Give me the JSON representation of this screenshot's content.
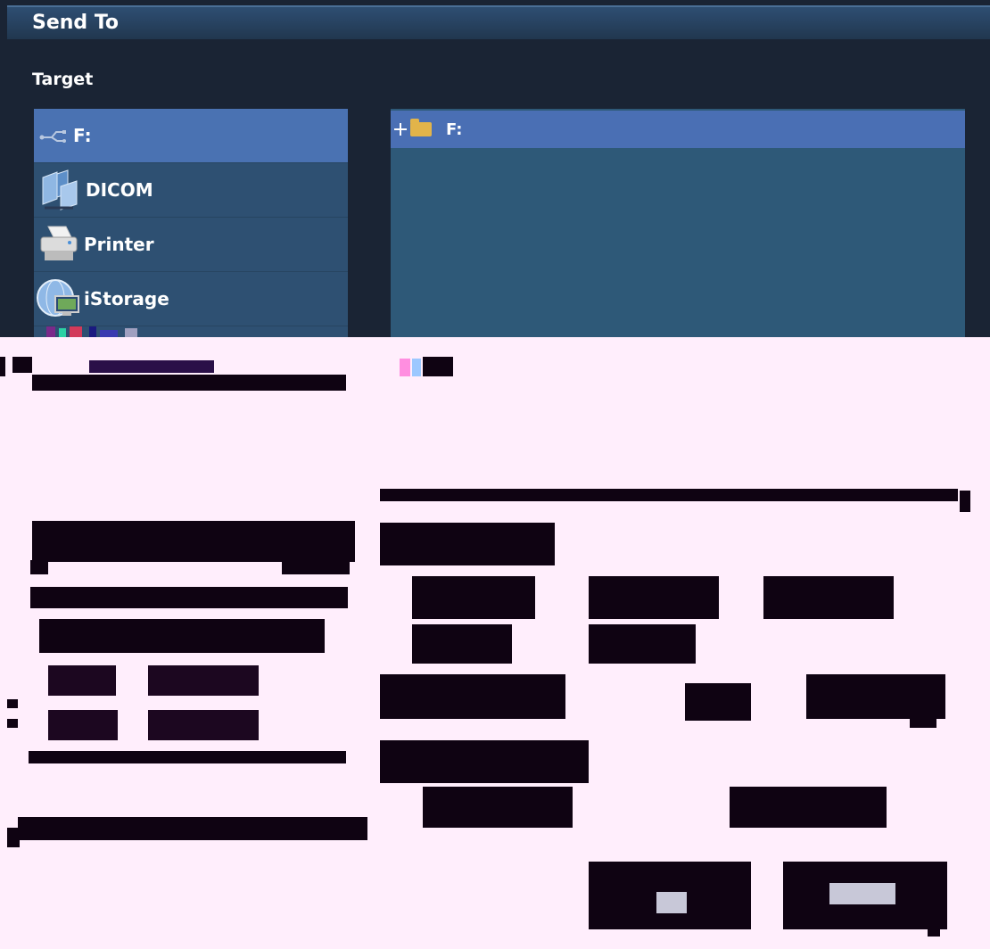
{
  "dialog": {
    "title": "Send To",
    "section_label": "Target"
  },
  "targets": [
    {
      "label": "F:",
      "icon": "usb-icon",
      "selected": true
    },
    {
      "label": "DICOM",
      "icon": "network-icon",
      "selected": false
    },
    {
      "label": "Printer",
      "icon": "printer-icon",
      "selected": false
    },
    {
      "label": "iStorage",
      "icon": "istorage-icon",
      "selected": false
    }
  ],
  "tree": {
    "root_label": "F:",
    "root_icon": "folder-icon",
    "expand_icon": "plus-icon"
  },
  "colors": {
    "background": "#1a2434",
    "title_bar": "#2e4e72",
    "list_background": "#2e5072",
    "selected": "#4a72b2",
    "text": "#ffffff"
  }
}
